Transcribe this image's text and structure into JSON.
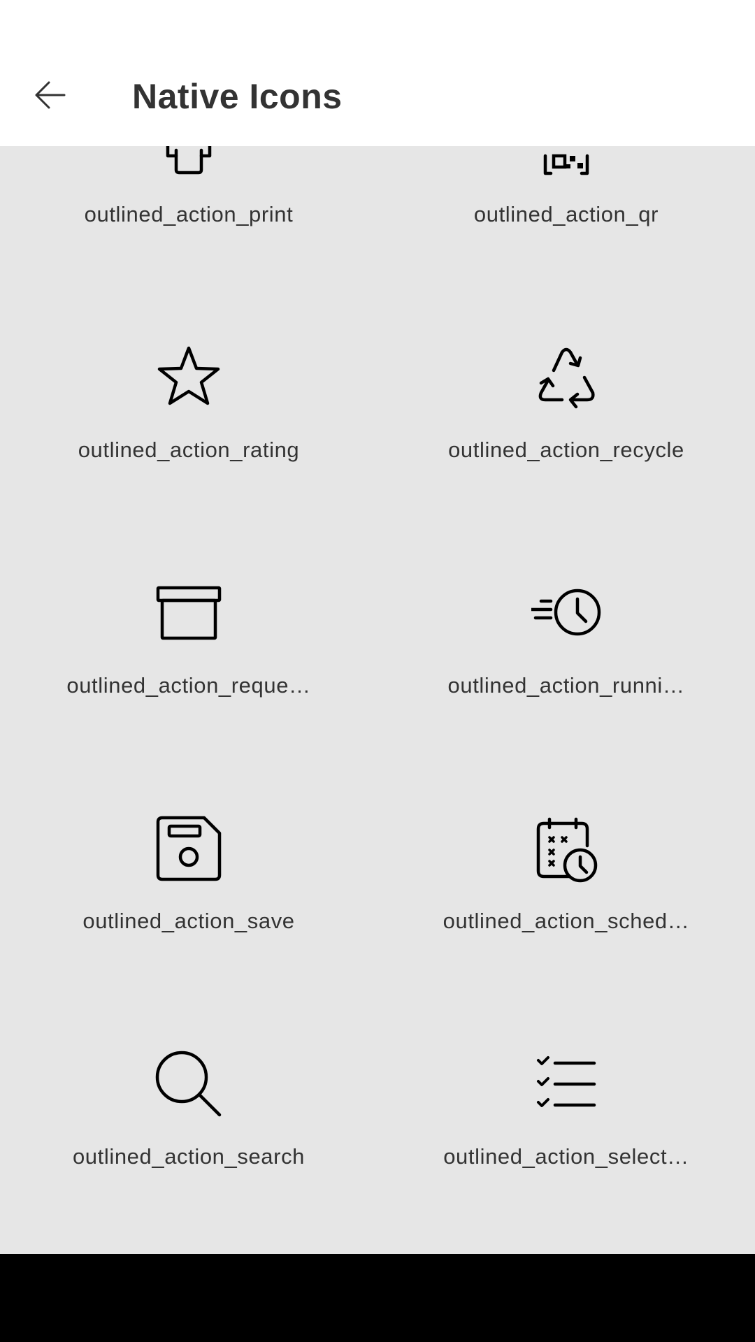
{
  "header": {
    "title": "Native Icons",
    "back_icon": "arrow-left-icon"
  },
  "grid": {
    "items": [
      {
        "label": "outlined_action_print",
        "icon": "print-icon"
      },
      {
        "label": "outlined_action_qr",
        "icon": "qr-icon"
      },
      {
        "label": "outlined_action_rating",
        "icon": "star-icon"
      },
      {
        "label": "outlined_action_recycle",
        "icon": "recycle-icon"
      },
      {
        "label": "outlined_action_reque…",
        "icon": "archive-box-icon"
      },
      {
        "label": "outlined_action_runni…",
        "icon": "running-clock-icon"
      },
      {
        "label": "outlined_action_save",
        "icon": "floppy-disk-icon"
      },
      {
        "label": "outlined_action_sched…",
        "icon": "calendar-clock-icon"
      },
      {
        "label": "outlined_action_search",
        "icon": "search-icon"
      },
      {
        "label": "outlined_action_select…",
        "icon": "checklist-icon"
      }
    ]
  },
  "colors": {
    "header_bg": "#ffffff",
    "content_bg": "#e6e6e6",
    "text": "#333333",
    "icon_stroke": "#000000",
    "navbar": "#000000"
  }
}
